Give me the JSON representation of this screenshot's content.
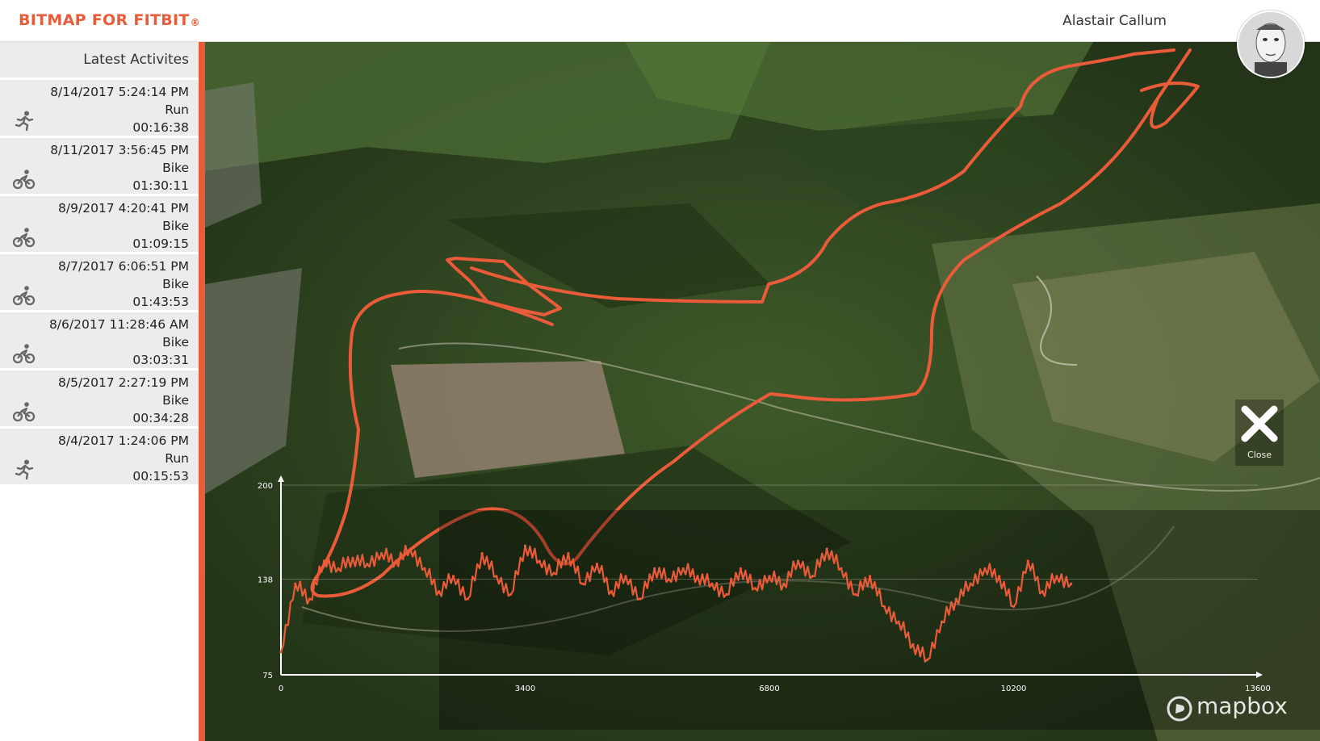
{
  "app": {
    "brand": "BITMAP FOR FITBIT",
    "brand_mark": "®"
  },
  "user": {
    "name": "Alastair Callum",
    "avatar_icon": "user-avatar"
  },
  "sidebar": {
    "title": "Latest Activites",
    "items": [
      {
        "date": "8/14/2017 5:24:14 PM",
        "type": "Run",
        "duration": "00:16:38",
        "icon": "run-icon"
      },
      {
        "date": "8/11/2017 3:56:45 PM",
        "type": "Bike",
        "duration": "01:30:11",
        "icon": "bike-icon"
      },
      {
        "date": "8/9/2017 4:20:41 PM",
        "type": "Bike",
        "duration": "01:09:15",
        "icon": "bike-icon"
      },
      {
        "date": "8/7/2017 6:06:51 PM",
        "type": "Bike",
        "duration": "01:43:53",
        "icon": "bike-icon"
      },
      {
        "date": "8/6/2017 11:28:46 AM",
        "type": "Bike",
        "duration": "03:03:31",
        "icon": "bike-icon"
      },
      {
        "date": "8/5/2017 2:27:19 PM",
        "type": "Bike",
        "duration": "00:34:28",
        "icon": "bike-icon"
      },
      {
        "date": "8/4/2017 1:24:06 PM",
        "type": "Run",
        "duration": "00:15:53",
        "icon": "run-icon"
      }
    ]
  },
  "map": {
    "attribution": "mapbox",
    "route_color": "#ea5b3a",
    "close_label": "Close"
  },
  "chart_data": {
    "type": "line",
    "xlim": [
      0,
      13600
    ],
    "ylim": [
      75,
      200
    ],
    "x_ticks": [
      "0",
      "3400",
      "6800",
      "10200",
      "13600"
    ],
    "y_ticks": [
      "75",
      "138",
      "200"
    ],
    "series": [
      {
        "color": "#ea5b3a",
        "x": [
          0,
          200,
          400,
          600,
          800,
          1000,
          1200,
          1400,
          1600,
          1800,
          2000,
          2200,
          2400,
          2600,
          2800,
          3000,
          3200,
          3400,
          3600,
          3800,
          4000,
          4200,
          4400,
          4600,
          4800,
          5000,
          5200,
          5400,
          5600,
          5800,
          6000,
          6200,
          6400,
          6600,
          6800,
          7000,
          7200,
          7400,
          7600,
          7800,
          8000,
          8200,
          8400,
          8600,
          8800,
          9000,
          9200,
          9400,
          9600,
          9800,
          10000,
          10200,
          10400,
          10600,
          10800,
          11000
        ],
        "values": [
          90,
          135,
          125,
          150,
          145,
          152,
          148,
          155,
          150,
          158,
          145,
          130,
          140,
          125,
          155,
          140,
          128,
          160,
          150,
          142,
          155,
          135,
          148,
          130,
          140,
          125,
          145,
          138,
          145,
          140,
          135,
          128,
          145,
          132,
          140,
          135,
          150,
          140,
          158,
          145,
          128,
          140,
          120,
          110,
          95,
          85,
          110,
          125,
          135,
          145,
          140,
          120,
          150,
          130,
          140,
          135
        ]
      }
    ]
  }
}
